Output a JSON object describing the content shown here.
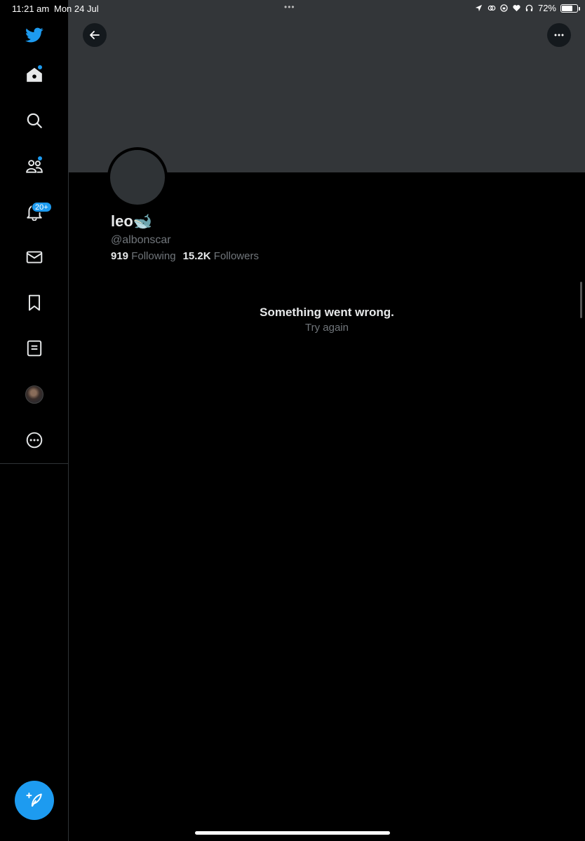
{
  "status_bar": {
    "time": "11:21 am",
    "date": "Mon 24 Jul",
    "dots": "•••",
    "battery_percent": "72%",
    "battery_level": 0.72
  },
  "sidebar": {
    "notifications_badge": "20+",
    "items": [
      {
        "name": "home",
        "icon": "home-icon"
      },
      {
        "name": "explore",
        "icon": "search-icon"
      },
      {
        "name": "communities",
        "icon": "communities-icon"
      },
      {
        "name": "notifications",
        "icon": "bell-icon"
      },
      {
        "name": "messages",
        "icon": "mail-icon"
      },
      {
        "name": "bookmarks",
        "icon": "bookmark-icon"
      },
      {
        "name": "lists",
        "icon": "list-icon"
      },
      {
        "name": "profile",
        "icon": "avatar"
      },
      {
        "name": "more",
        "icon": "more-circle-icon"
      }
    ],
    "compose_icon": "compose-icon"
  },
  "profile": {
    "name": "leo🐋",
    "handle": "@albonscar",
    "following_count": "919",
    "following_label": "Following",
    "followers_count": "15.2K",
    "followers_label": "Followers"
  },
  "error": {
    "title": "Something went wrong.",
    "retry": "Try again"
  },
  "colors": {
    "accent": "#1d9bf0",
    "background": "#000000",
    "banner": "#333639",
    "muted_text": "#71767b"
  }
}
